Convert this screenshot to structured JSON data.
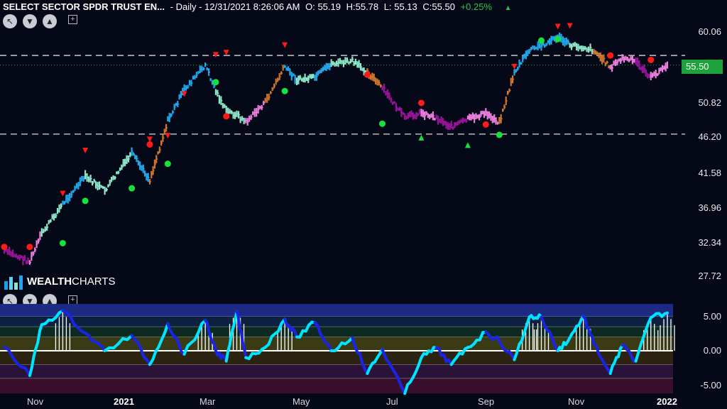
{
  "header": {
    "symbol": "SELECT SECTOR SPDR TRUST EN...",
    "period": "- Daily - 12/31/2021 8:26:06 AM",
    "open": "O: 55.19",
    "high": "H:55.78",
    "low": "L: 55.13",
    "close": "C:55.50",
    "change": "+0.25%",
    "change_arrow": "▲"
  },
  "logo": {
    "bold": "WEALTH",
    "light": "CHARTS"
  },
  "colors": {
    "background": "#050817",
    "bull_strong": "#22a8ef",
    "bull_weak": "#8fe8c9",
    "bear_weak": "#ee7fe0",
    "bear_strong": "#9a149b",
    "neutral": "#d0762e",
    "buy_dot": "#17e23d",
    "sell_dot": "#ff1a1a",
    "price_badge": "#1ea23c",
    "osc_line_up": "#00e5ff",
    "osc_line_down": "#1a24e6"
  },
  "price_badge": "55.50",
  "chart_data": [
    {
      "type": "line",
      "y_ticks": [
        "60.06",
        "55.50",
        "50.82",
        "46.20",
        "41.58",
        "36.96",
        "32.34",
        "27.72"
      ],
      "x_ticks": [
        "Nov",
        "2021",
        "Mar",
        "May",
        "Jul",
        "Sep",
        "Nov",
        "2022"
      ],
      "ylim": [
        26.0,
        62.0
      ],
      "horizontal_levels": [
        56.8,
        46.2
      ],
      "last_price": 55.5,
      "series": [
        {
          "x": [
            "2020-10-15",
            "2020-11-01",
            "2020-11-09",
            "2020-11-23",
            "2020-12-08",
            "2020-12-21",
            "2021-01-08",
            "2021-01-20",
            "2021-02-01",
            "2021-02-12",
            "2021-02-26",
            "2021-03-05",
            "2021-03-12",
            "2021-03-19",
            "2021-03-25",
            "2021-04-07",
            "2021-04-20",
            "2021-04-28",
            "2021-05-10",
            "2021-05-21",
            "2021-06-04",
            "2021-06-14",
            "2021-06-24",
            "2021-07-09",
            "2021-07-20",
            "2021-07-30",
            "2021-08-09",
            "2021-08-20",
            "2021-09-01",
            "2021-09-10",
            "2021-09-20",
            "2021-09-30",
            "2021-10-08",
            "2021-10-19",
            "2021-10-27",
            "2021-11-05",
            "2021-11-12",
            "2021-11-23",
            "2021-12-01",
            "2021-12-10",
            "2021-12-20",
            "2021-12-31"
          ],
          "y": [
            30.5,
            29.0,
            32.8,
            36.8,
            40.5,
            38.6,
            43.6,
            40.0,
            48.0,
            52.2,
            55.5,
            52.0,
            49.3,
            48.8,
            47.8,
            50.5,
            55.3,
            53.5,
            53.8,
            55.7,
            56.0,
            54.6,
            52.4,
            48.4,
            49.1,
            48.4,
            47.2,
            48.2,
            49.0,
            47.8,
            54.5,
            57.5,
            58.1,
            59.3,
            58.2,
            57.9,
            57.5,
            55.2,
            56.4,
            56.0,
            53.8,
            55.5
          ],
          "trend": [
            "bear_strong",
            "bear_weak",
            "bull_weak",
            "bull_strong",
            "bull_weak",
            "bull_weak",
            "bull_strong",
            "neutral",
            "bull_strong",
            "bull_strong",
            "bull_strong",
            "bull_weak",
            "bull_weak",
            "bull_weak",
            "bear_weak",
            "neutral",
            "bull_strong",
            "bull_weak",
            "bull_strong",
            "bull_weak",
            "bull_weak",
            "neutral",
            "bear_strong",
            "bear_strong",
            "bear_weak",
            "bear_strong",
            "bear_strong",
            "bear_weak",
            "bear_weak",
            "neutral",
            "bull_strong",
            "bull_strong",
            "bull_strong",
            "bull_strong",
            "bull_weak",
            "bull_weak",
            "neutral",
            "bear_weak",
            "bear_weak",
            "bear_strong",
            "bear_weak",
            "bear_weak"
          ]
        }
      ],
      "buy_dots": [
        [
          3,
          31.5
        ],
        [
          4,
          37.2
        ],
        [
          6,
          38.9
        ],
        [
          8,
          42.2
        ],
        [
          11,
          53.2
        ],
        [
          16,
          52.0
        ],
        [
          22,
          47.6
        ],
        [
          29,
          46.1
        ],
        [
          32,
          58.8
        ],
        [
          33,
          59.0
        ]
      ],
      "sell_dots": [
        [
          0,
          31.0
        ],
        [
          1,
          31.0
        ],
        [
          7,
          44.8
        ],
        [
          12,
          48.6
        ],
        [
          21,
          54.2
        ],
        [
          24,
          50.4
        ],
        [
          28,
          47.5
        ],
        [
          37,
          56.8
        ],
        [
          40,
          56.2
        ]
      ],
      "buy_triangles": [
        [
          24,
          46.1
        ],
        [
          27,
          45.1
        ]
      ],
      "sell_triangles": [
        [
          3,
          37.8
        ],
        [
          4,
          43.6
        ],
        [
          7,
          45.1
        ],
        [
          8,
          45.6
        ],
        [
          9,
          51.2
        ],
        [
          11,
          56.5
        ],
        [
          12,
          56.8
        ],
        [
          16,
          57.8
        ],
        [
          30,
          54.9
        ],
        [
          33,
          60.3
        ],
        [
          34,
          60.4
        ]
      ]
    },
    {
      "type": "line",
      "y_ticks": [
        "5.00",
        "0.00",
        "-5.00"
      ],
      "ylim": [
        -6.5,
        7.0
      ],
      "series": [
        {
          "x": [
            "2020-10-15",
            "2020-11-01",
            "2020-11-09",
            "2020-11-23",
            "2020-12-08",
            "2020-12-21",
            "2021-01-08",
            "2021-01-20",
            "2021-02-01",
            "2021-02-12",
            "2021-02-26",
            "2021-03-05",
            "2021-03-12",
            "2021-03-19",
            "2021-03-25",
            "2021-04-07",
            "2021-04-20",
            "2021-04-28",
            "2021-05-10",
            "2021-05-21",
            "2021-06-04",
            "2021-06-14",
            "2021-06-24",
            "2021-07-09",
            "2021-07-20",
            "2021-07-30",
            "2021-08-09",
            "2021-08-20",
            "2021-09-01",
            "2021-09-10",
            "2021-09-20",
            "2021-09-30",
            "2021-10-08",
            "2021-10-19",
            "2021-10-27",
            "2021-11-05",
            "2021-11-12",
            "2021-11-23",
            "2021-12-01",
            "2021-12-10",
            "2021-12-20",
            "2021-12-31"
          ],
          "y": [
            0.5,
            -3.6,
            3.8,
            5.8,
            2.6,
            0.0,
            2.2,
            -2.0,
            3.9,
            -0.5,
            4.4,
            0.0,
            -1.5,
            5.7,
            -1.0,
            0.5,
            4.6,
            2.0,
            4.1,
            0.0,
            1.9,
            -3.3,
            0.2,
            -6.2,
            -1.0,
            0.4,
            -2.0,
            0.5,
            2.7,
            1.4,
            -1.3,
            4.9,
            4.9,
            0.0,
            1.9,
            5.0,
            1.0,
            -3.3,
            0.8,
            -1.5,
            4.8,
            5.5
          ]
        }
      ]
    }
  ]
}
